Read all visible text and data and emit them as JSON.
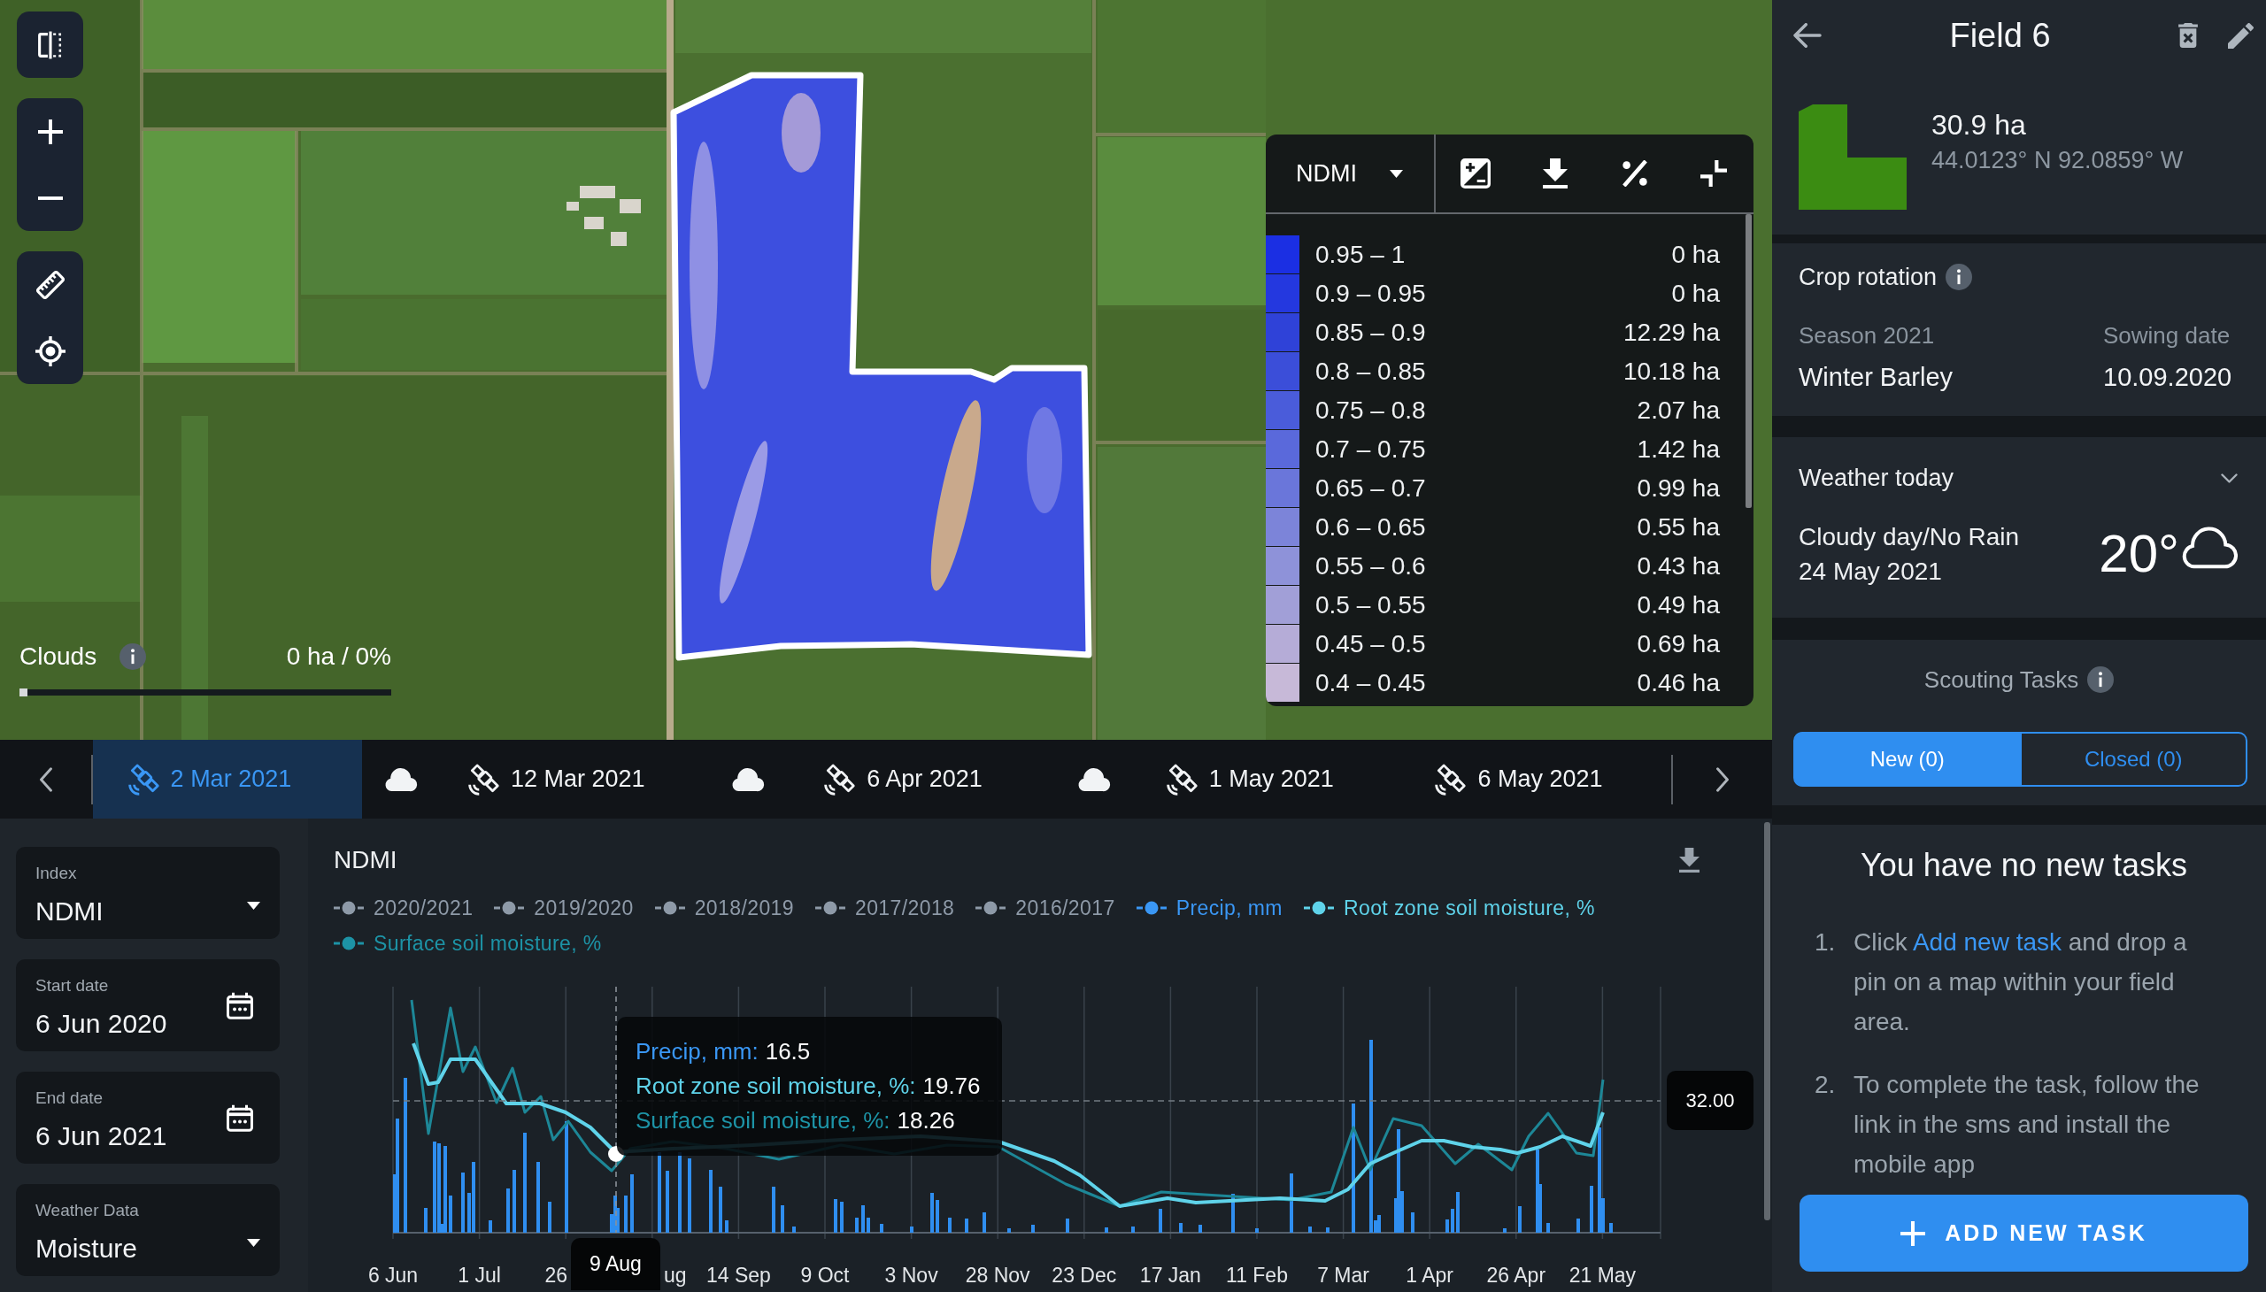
{
  "map": {
    "clouds": {
      "label": "Clouds",
      "value": "0 ha / 0%",
      "level": 0
    },
    "legend": {
      "index": "NDMI",
      "rows": [
        {
          "range": "0.95 – 1",
          "area": "0 ha",
          "color": "#1b2fe3"
        },
        {
          "range": "0.9 – 0.95",
          "area": "0 ha",
          "color": "#2438df"
        },
        {
          "range": "0.85 – 0.9",
          "area": "12.29 ha",
          "color": "#2f42d8"
        },
        {
          "range": "0.8 – 0.85",
          "area": "10.18 ha",
          "color": "#3b4ed9"
        },
        {
          "range": "0.75 – 0.8",
          "area": "2.07 ha",
          "color": "#4a5cda"
        },
        {
          "range": "0.7 – 0.75",
          "area": "1.42 ha",
          "color": "#5a69db"
        },
        {
          "range": "0.65 – 0.7",
          "area": "0.99 ha",
          "color": "#6a76da"
        },
        {
          "range": "0.6 – 0.65",
          "area": "0.55 ha",
          "color": "#7c84d9"
        },
        {
          "range": "0.55 – 0.6",
          "area": "0.43 ha",
          "color": "#8e92d9"
        },
        {
          "range": "0.5 – 0.55",
          "area": "0.49 ha",
          "color": "#a19fd7"
        },
        {
          "range": "0.45 – 0.5",
          "area": "0.69 ha",
          "color": "#b5acd7"
        },
        {
          "range": "0.4 – 0.45",
          "area": "0.46 ha",
          "color": "#c7b9d8"
        }
      ]
    }
  },
  "timeline": [
    {
      "kind": "satellite",
      "label": "2 Mar 2021",
      "selected": true
    },
    {
      "kind": "cloud",
      "selected": false
    },
    {
      "kind": "satellite",
      "label": "12 Mar 2021",
      "selected": false
    },
    {
      "kind": "cloud",
      "selected": false
    },
    {
      "kind": "satellite",
      "label": "6 Apr 2021",
      "selected": false
    },
    {
      "kind": "cloud",
      "selected": false
    },
    {
      "kind": "satellite",
      "label": "1 May 2021",
      "selected": false
    },
    {
      "kind": "satellite",
      "label": "6 May 2021",
      "selected": false
    }
  ],
  "filters": [
    {
      "kind": "select",
      "label": "Index",
      "value": "NDMI"
    },
    {
      "kind": "date",
      "label": "Start date",
      "value": "6 Jun 2020"
    },
    {
      "kind": "date",
      "label": "End date",
      "value": "6 Jun 2021"
    },
    {
      "kind": "select",
      "label": "Weather Data",
      "value": "Moisture"
    }
  ],
  "chart": {
    "title": "NDMI",
    "legend": [
      {
        "label": "2020/2021",
        "color": "#8e9aa8"
      },
      {
        "label": "2019/2020",
        "color": "#8e9aa8"
      },
      {
        "label": "2018/2019",
        "color": "#8e9aa8"
      },
      {
        "label": "2017/2018",
        "color": "#8e9aa8"
      },
      {
        "label": "2016/2017",
        "color": "#8e9aa8"
      },
      {
        "label": "Precip, mm",
        "color": "#3a97f5"
      },
      {
        "label": "Root zone soil moisture, %",
        "color": "#5fd3ea"
      },
      {
        "label": "Surface soil moisture, %",
        "color": "#1d93a6"
      }
    ],
    "x_labels": [
      "6 Jun",
      "1 Jul",
      "26",
      "ug",
      "14 Sep",
      "9 Oct",
      "3 Nov",
      "28 Nov",
      "23 Dec",
      "17 Jan",
      "11 Feb",
      "7 Mar",
      "1 Apr",
      "26 Apr",
      "21 May"
    ],
    "tooltip": {
      "date": "9 Aug",
      "rows": [
        {
          "label": "Precip, mm:",
          "value": "16.5",
          "color": "#3a97f5"
        },
        {
          "label": "Root zone soil moisture, %:",
          "value": "19.76",
          "color": "#5fd3ea"
        },
        {
          "label": "Surface soil moisture, %:",
          "value": "18.26",
          "color": "#1d93a6"
        }
      ]
    },
    "marker_value": "32.00"
  },
  "field": {
    "title": "Field 6",
    "area": "30.9 ha",
    "coordinates": "44.0123° N 92.0859° W"
  },
  "crop_rotation": {
    "title": "Crop rotation",
    "season": "Season 2021",
    "crop": "Winter Barley",
    "sowing_label": "Sowing date",
    "sowing_date": "10.09.2020"
  },
  "weather": {
    "title": "Weather today",
    "condition": "Cloudy day/No Rain",
    "date": "24 May 2021",
    "temperature": "20°"
  },
  "scouting": {
    "title": "Scouting Tasks",
    "tabs": [
      {
        "label": "New (0)",
        "selected": true
      },
      {
        "label": "Closed (0)",
        "selected": false
      }
    ],
    "empty_title": "You have no new tasks",
    "steps": [
      {
        "number": "1.",
        "text": "Click",
        "link": "Add new task",
        "after": "and drop a pin on a map within your field area."
      },
      {
        "number": "2.",
        "text": "To complete the task, follow the link in the sms and install the mobile app"
      }
    ],
    "button": "ADD NEW TASK"
  }
}
